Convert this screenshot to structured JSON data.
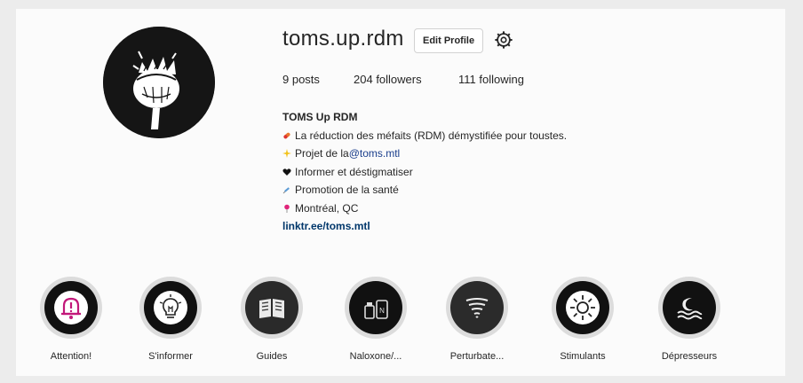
{
  "profile": {
    "username": "toms.up.rdm",
    "edit_profile_label": "Edit Profile",
    "stats": {
      "posts_count": "9",
      "posts_label": " posts",
      "followers_count": "204",
      "followers_label": " followers",
      "following_count": "111",
      "following_label": " following"
    },
    "bio": {
      "name": "TOMS Up RDM",
      "line1": "La réduction des méfaits (RDM) démystifiée pour toustes.",
      "line2_prefix": "Projet de la ",
      "line2_mention": "@toms.mtl",
      "line3": "Informer et déstigmatiser",
      "line4": "Promotion de la santé",
      "line5": "Montréal, QC",
      "link": "linktr.ee/toms.mtl"
    }
  },
  "highlights": [
    {
      "label": "Attention!",
      "icon": "bell-icon"
    },
    {
      "label": "S'informer",
      "icon": "lightbulb-icon"
    },
    {
      "label": "Guides",
      "icon": "book-icon"
    },
    {
      "label": "Naloxone/...",
      "icon": "naloxone-kit-icon"
    },
    {
      "label": "Perturbate...",
      "icon": "tornado-icon"
    },
    {
      "label": "Stimulants",
      "icon": "sun-icon"
    },
    {
      "label": "Dépresseurs",
      "icon": "moon-waves-icon"
    }
  ],
  "colors": {
    "accent_pink": "#c2187a",
    "link_blue": "#00376b",
    "avatar_bg": "#151515"
  }
}
